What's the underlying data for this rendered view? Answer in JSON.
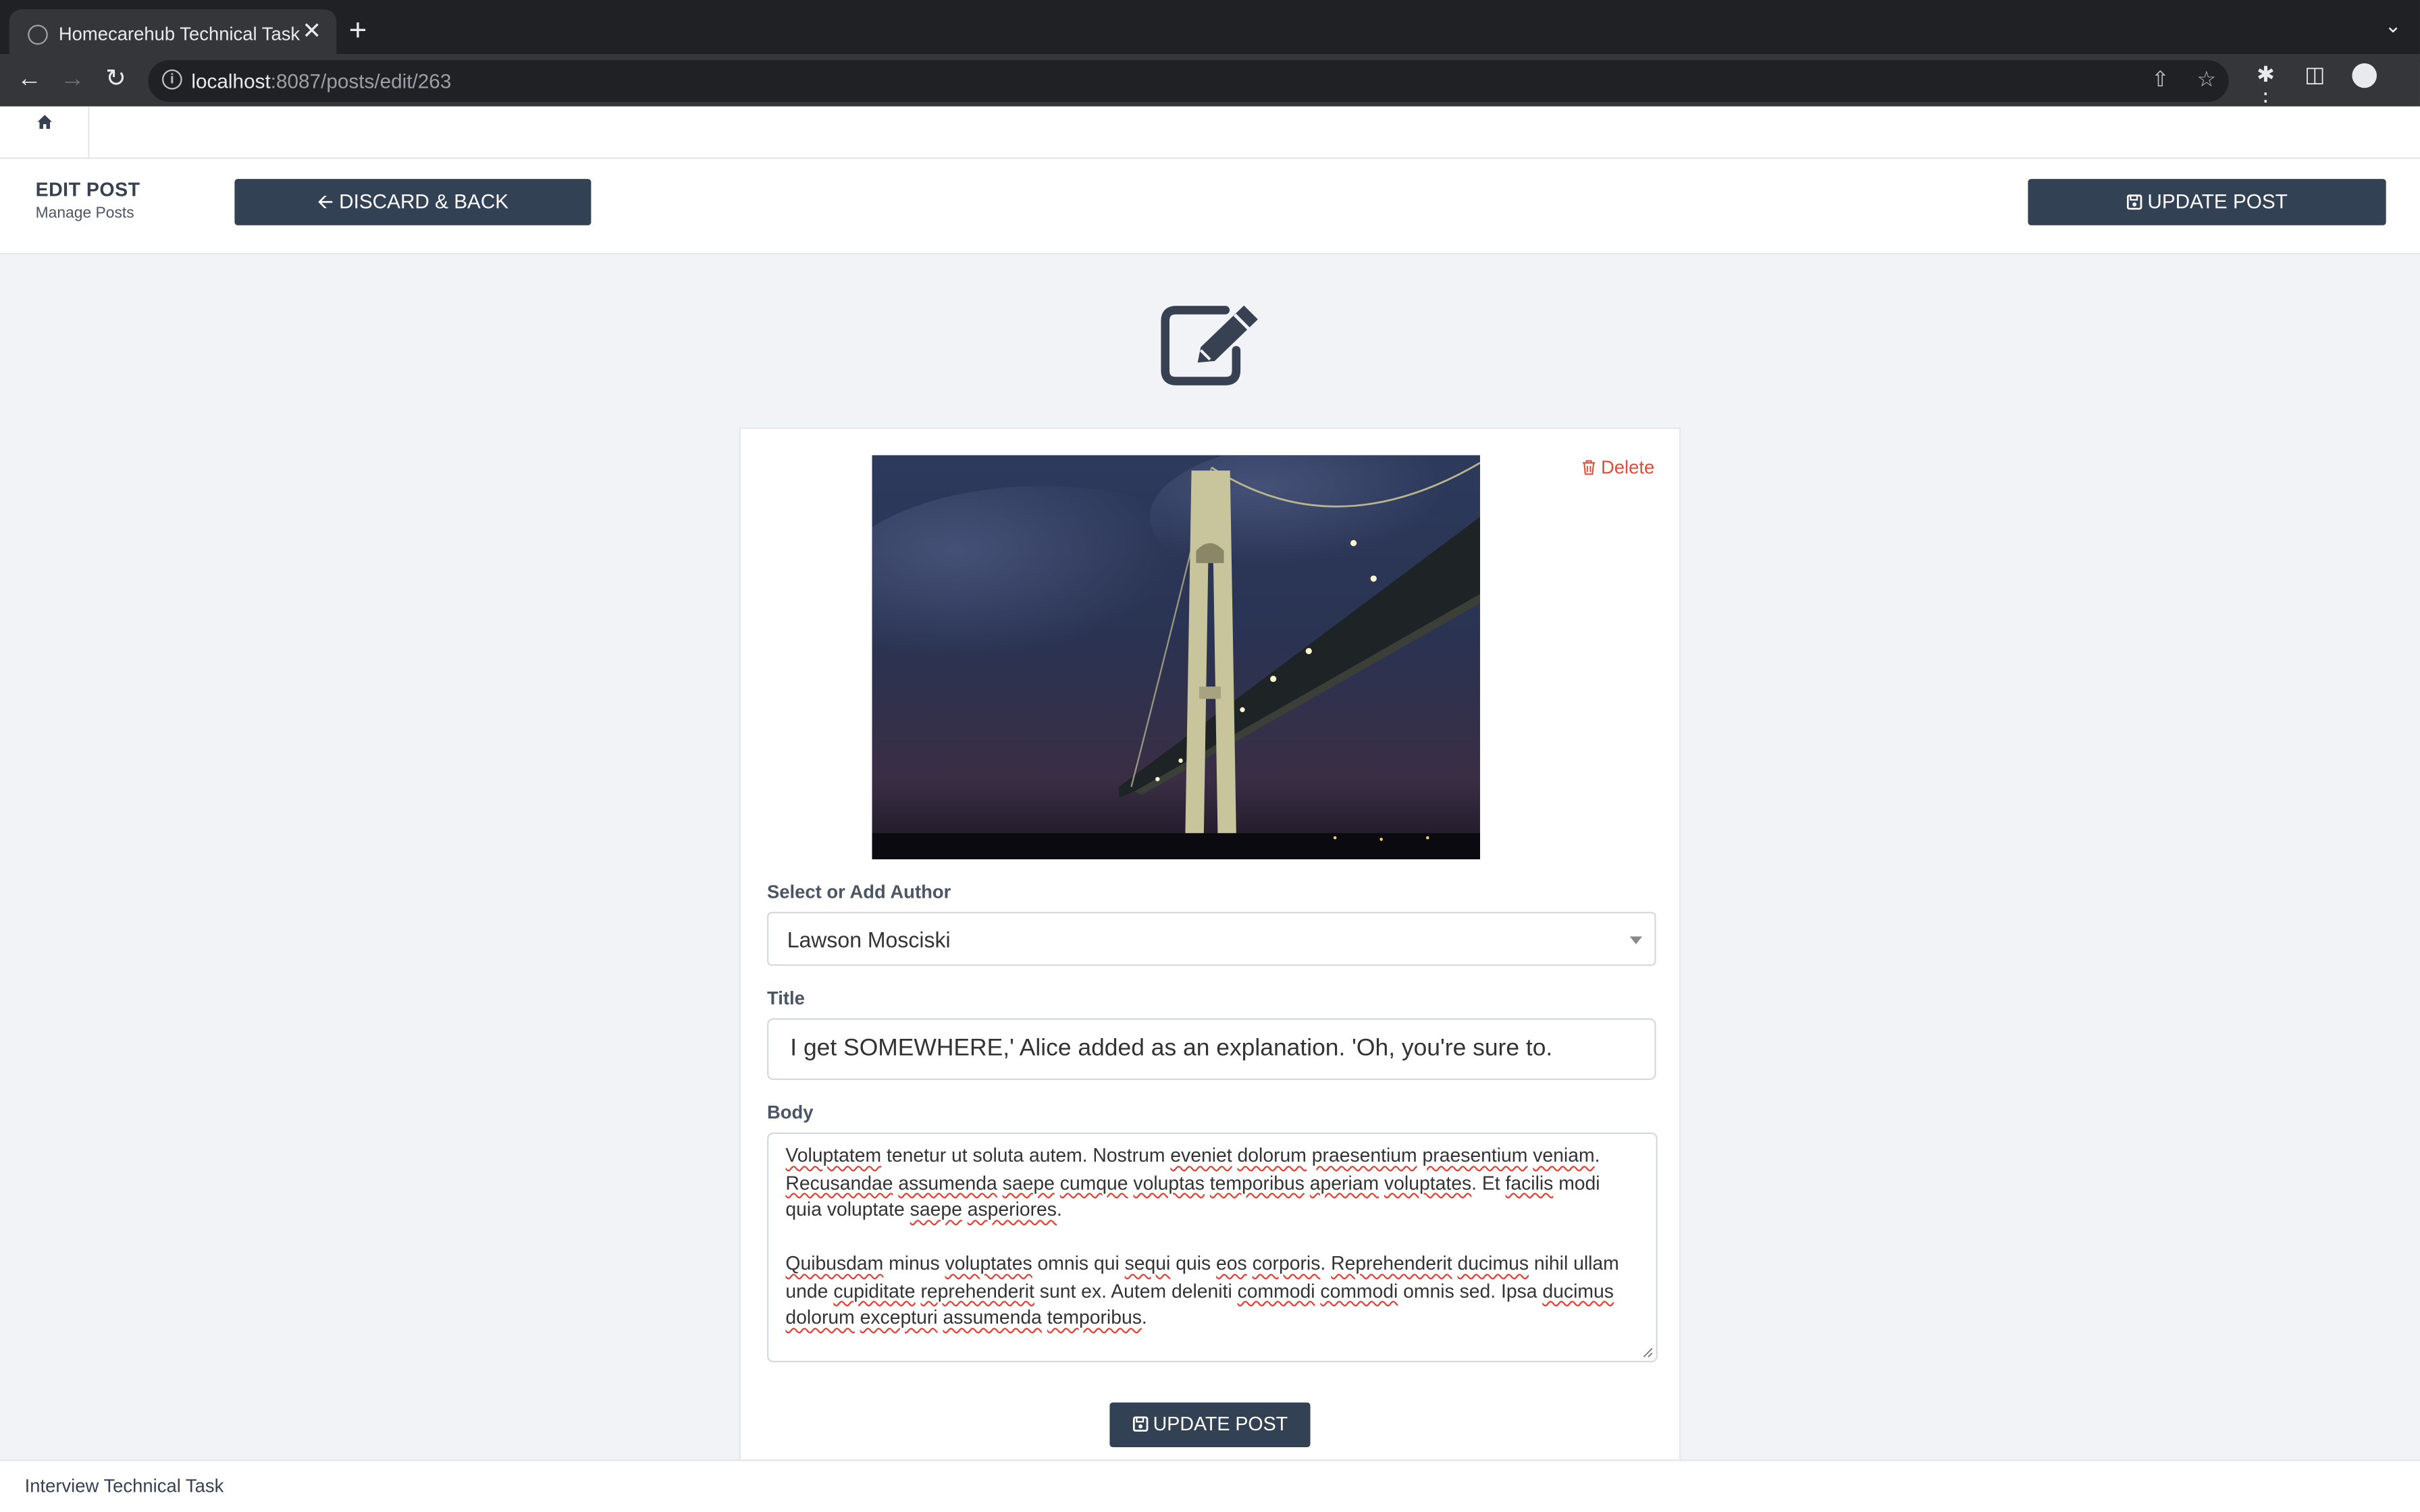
{
  "browser": {
    "tab_title": "Homecarehub Technical Task",
    "tab_close": "✕",
    "new_tab": "+",
    "url_host": "localhost",
    "url_path": ":8087/posts/edit/263"
  },
  "header": {
    "title": "EDIT POST",
    "subtitle": "Manage Posts",
    "discard_label": "DISCARD & BACK",
    "update_label": "UPDATE POST"
  },
  "form": {
    "delete_label": "Delete",
    "author_label": "Select or Add Author",
    "author_value": "Lawson Mosciski",
    "title_label": "Title",
    "title_value": "I get SOMEWHERE,' Alice added as an explanation. 'Oh, you're sure to.",
    "body_label": "Body",
    "body_paragraphs": [
      [
        {
          "t": "Voluptatem",
          "sp": true
        },
        {
          "t": " tenetur ut soluta autem. Nostrum "
        },
        {
          "t": "eveniet",
          "sp": true
        },
        {
          "t": " "
        },
        {
          "t": "dolorum",
          "sp": true
        },
        {
          "t": " "
        },
        {
          "t": "praesentium",
          "sp": true
        },
        {
          "t": " "
        },
        {
          "t": "praesentium",
          "sp": true
        },
        {
          "t": " "
        },
        {
          "t": "veniam",
          "sp": true
        },
        {
          "t": ". "
        },
        {
          "t": "Recusandae",
          "sp": true
        },
        {
          "t": " "
        },
        {
          "t": "assumenda",
          "sp": true
        },
        {
          "t": " "
        },
        {
          "t": "saepe",
          "sp": true
        },
        {
          "t": " "
        },
        {
          "t": "cumque",
          "sp": true
        },
        {
          "t": " "
        },
        {
          "t": "voluptas",
          "sp": true
        },
        {
          "t": " "
        },
        {
          "t": "temporibus",
          "sp": true
        },
        {
          "t": " "
        },
        {
          "t": "aperiam",
          "sp": true
        },
        {
          "t": " "
        },
        {
          "t": "voluptates",
          "sp": true
        },
        {
          "t": ". Et "
        },
        {
          "t": "facilis",
          "sp": true
        },
        {
          "t": " modi quia voluptate "
        },
        {
          "t": "saepe",
          "sp": true
        },
        {
          "t": " "
        },
        {
          "t": "asperiores",
          "sp": true
        },
        {
          "t": "."
        }
      ],
      [
        {
          "t": "Quibusdam",
          "sp": true
        },
        {
          "t": " minus "
        },
        {
          "t": "voluptates",
          "sp": true
        },
        {
          "t": " omnis qui "
        },
        {
          "t": "sequi",
          "sp": true
        },
        {
          "t": " quis "
        },
        {
          "t": "eos",
          "sp": true
        },
        {
          "t": " "
        },
        {
          "t": "corporis",
          "sp": true
        },
        {
          "t": ". "
        },
        {
          "t": "Reprehenderit",
          "sp": true
        },
        {
          "t": " "
        },
        {
          "t": "ducimus",
          "sp": true
        },
        {
          "t": " nihil ullam unde "
        },
        {
          "t": "cupiditate",
          "sp": true
        },
        {
          "t": " "
        },
        {
          "t": "reprehenderit",
          "sp": true
        },
        {
          "t": " sunt ex. Autem deleniti "
        },
        {
          "t": "commodi",
          "sp": true
        },
        {
          "t": " "
        },
        {
          "t": "commodi",
          "sp": true
        },
        {
          "t": " omnis sed. Ipsa "
        },
        {
          "t": "ducimus",
          "sp": true
        },
        {
          "t": " "
        },
        {
          "t": "dolorum",
          "sp": true
        },
        {
          "t": " "
        },
        {
          "t": "excepturi",
          "sp": true
        },
        {
          "t": " "
        },
        {
          "t": "assumenda",
          "sp": true
        },
        {
          "t": " "
        },
        {
          "t": "temporibus",
          "sp": true
        },
        {
          "t": "."
        }
      ]
    ],
    "submit_label": "UPDATE POST"
  },
  "footer": {
    "text": "Interview Technical Task"
  },
  "icons": {
    "tab_favicon": "globe-icon",
    "home": "home-icon",
    "discard": "arrow-left-icon",
    "update": "save-icon",
    "edit": "edit-square-icon",
    "delete": "trash-icon",
    "select_caret": "caret-down-icon"
  },
  "colors": {
    "primary_button": "#334155",
    "delete": "#e24b3b",
    "page_bg": "#f1f3f6",
    "browser_bg": "#202124"
  }
}
